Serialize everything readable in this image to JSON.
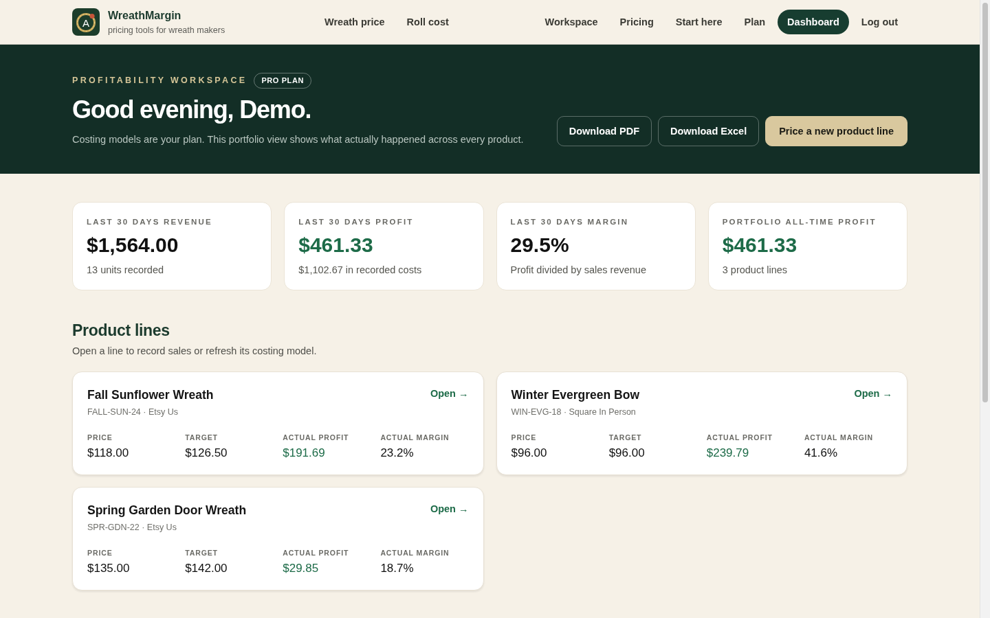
{
  "header": {
    "brand": {
      "mark": "A",
      "name": "WreathMargin",
      "tagline": "pricing tools for wreath makers"
    },
    "tools_nav": [
      {
        "label": "Wreath price",
        "selected": false
      },
      {
        "label": "Roll cost",
        "selected": false
      }
    ],
    "main_nav": [
      {
        "label": "Workspace",
        "selected": false
      },
      {
        "label": "Pricing",
        "selected": false
      },
      {
        "label": "Start here",
        "selected": false
      },
      {
        "label": "Plan",
        "selected": false
      },
      {
        "label": "Dashboard",
        "selected": true
      }
    ],
    "logout": "Log out"
  },
  "hero": {
    "eyebrow": "PROFITABILITY WORKSPACE",
    "badge": "PRO PLAN",
    "title": "Good evening, Demo.",
    "description": "Costing models are your plan. This portfolio view shows what actually happened across every product.",
    "buttons": [
      {
        "label": "Download PDF",
        "kind": "outline"
      },
      {
        "label": "Download Excel",
        "kind": "outline"
      },
      {
        "label": "Price a new product line",
        "kind": "primary"
      }
    ]
  },
  "stats": [
    {
      "label": "LAST 30 DAYS REVENUE",
      "value": "$1,564.00",
      "note": "13 units recorded",
      "kind": "plain"
    },
    {
      "label": "LAST 30 DAYS PROFIT",
      "value": "$461.33",
      "note": "$1,102.67 in recorded costs",
      "kind": "profit"
    },
    {
      "label": "LAST 30 DAYS MARGIN",
      "value": "29.5%",
      "note": "Profit divided by sales revenue",
      "kind": "plain"
    },
    {
      "label": "PORTFOLIO ALL-TIME PROFIT",
      "value": "$461.33",
      "note": "3 product lines",
      "kind": "profit"
    }
  ],
  "product_lines": {
    "title": "Product lines",
    "subtitle": "Open a line to record sales or refresh its costing model.",
    "items": [
      {
        "name": "Fall Sunflower Wreath",
        "meta": "FALL-SUN-24 · Etsy Us",
        "action": "Open →",
        "metrics": [
          {
            "label": "PRICE",
            "value": "$118.00",
            "kind": "plain"
          },
          {
            "label": "TARGET",
            "value": "$126.50",
            "kind": "plain"
          },
          {
            "label": "ACTUAL PROFIT",
            "value": "$191.69",
            "kind": "profit"
          },
          {
            "label": "ACTUAL MARGIN",
            "value": "23.2%",
            "kind": "plain"
          }
        ]
      },
      {
        "name": "Winter Evergreen Bow",
        "meta": "WIN-EVG-18 · Square In Person",
        "action": "Open →",
        "metrics": [
          {
            "label": "PRICE",
            "value": "$96.00",
            "kind": "plain"
          },
          {
            "label": "TARGET",
            "value": "$96.00",
            "kind": "plain"
          },
          {
            "label": "ACTUAL PROFIT",
            "value": "$239.79",
            "kind": "profit"
          },
          {
            "label": "ACTUAL MARGIN",
            "value": "41.6%",
            "kind": "plain"
          }
        ]
      },
      {
        "name": "Spring Garden Door Wreath",
        "meta": "SPR-GDN-22 · Etsy Us",
        "action": "Open →",
        "metrics": [
          {
            "label": "PRICE",
            "value": "$135.00",
            "kind": "plain"
          },
          {
            "label": "TARGET",
            "value": "$142.00",
            "kind": "plain"
          },
          {
            "label": "ACTUAL PROFIT",
            "value": "$29.85",
            "kind": "profit"
          },
          {
            "label": "ACTUAL MARGIN",
            "value": "18.7%",
            "kind": "plain"
          }
        ]
      }
    ]
  }
}
